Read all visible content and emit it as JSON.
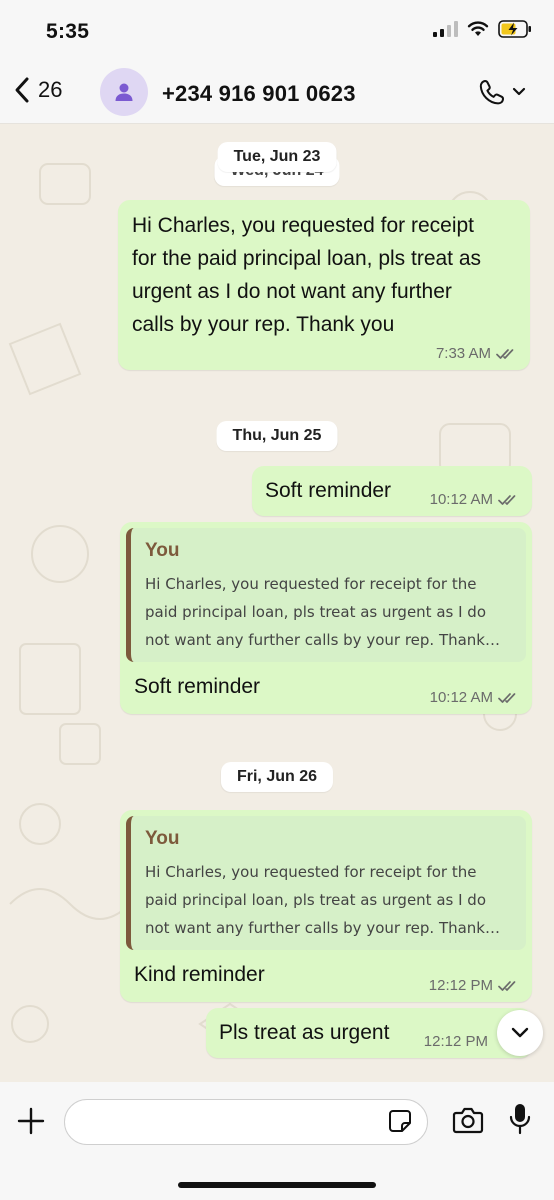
{
  "status_bar": {
    "time": "5:35"
  },
  "header": {
    "back_count": "26",
    "contact_name": "+234 916 901 0623"
  },
  "chat": {
    "date_separators": [
      "Tue, Jun 23",
      "Wed, Jun 24",
      "Thu, Jun 25",
      "Fri, Jun 26"
    ],
    "messages": [
      {
        "text_lines": [
          "Hi Charles, you requested for receipt",
          "for the paid principal loan, pls treat as",
          "urgent as I do not want any further",
          "calls by your rep. Thank you"
        ],
        "time": "7:33 AM"
      },
      {
        "text": "Soft reminder",
        "time": "10:12 AM"
      },
      {
        "quote": {
          "author": "You",
          "text_lines": [
            "Hi Charles, you requested for receipt for the",
            "paid principal loan, pls treat as urgent as I do",
            "not want any further calls by your rep. Thank…"
          ]
        },
        "text": "Soft reminder",
        "time": "10:12 AM"
      },
      {
        "quote": {
          "author": "You",
          "text_lines": [
            "Hi Charles, you requested for receipt for the",
            "paid principal loan, pls treat as urgent as I do",
            "not want any further calls by your rep. Thank…"
          ]
        },
        "text": "Kind reminder",
        "time": "12:12 PM"
      },
      {
        "text": "Pls treat as urgent",
        "time": "12:12 PM"
      }
    ]
  },
  "input_bar": {
    "placeholder": ""
  },
  "colors": {
    "bubble_out": "#dcf8c6",
    "quote_bar": "#7d5a3c",
    "chat_bg": "#f2ede4",
    "avatar_bg": "#dfd7f3",
    "avatar_icon": "#7b5ad1",
    "read_ticks": "#6b6b6b"
  },
  "icons": [
    "back-chevron-icon",
    "user-icon",
    "phone-icon",
    "chevron-down-icon",
    "double-check-icon",
    "plus-icon",
    "sticker-icon",
    "camera-icon",
    "microphone-icon",
    "signal-icon",
    "wifi-icon",
    "battery-charging-icon"
  ]
}
